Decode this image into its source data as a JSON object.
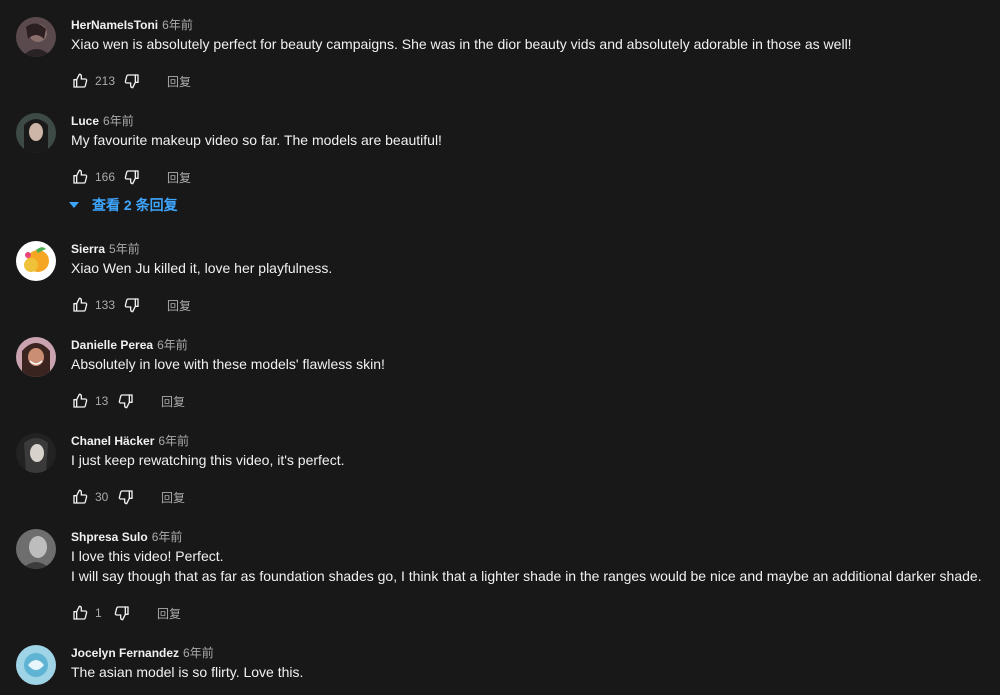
{
  "comments": [
    {
      "author": "HerNameIsToni",
      "time": "6年前",
      "text": "Xiao wen is absolutely perfect for beauty campaigns. She was in the dior beauty vids and absolutely adorable in those as well!",
      "likes": "213",
      "reply_label": "回复"
    },
    {
      "author": "Luce",
      "time": "6年前",
      "text": "My favourite makeup video so far. The models are beautiful!",
      "likes": "166",
      "reply_label": "回复",
      "view_replies": "查看 2 条回复"
    },
    {
      "author": "Sierra",
      "time": "5年前",
      "text": "Xiao Wen Ju killed it, love her playfulness.",
      "likes": "133",
      "reply_label": "回复"
    },
    {
      "author": "Danielle Perea",
      "time": "6年前",
      "text": "Absolutely in love with these models' flawless skin!",
      "likes": "13",
      "reply_label": "回复"
    },
    {
      "author": "Chanel Häcker",
      "time": "6年前",
      "text": "I just keep rewatching this video, it's perfect.",
      "likes": "30",
      "reply_label": "回复"
    },
    {
      "author": "Shpresa Sulo",
      "time": "6年前",
      "text_line1": "I love this video! Perfect.",
      "text_line2": "I will say though that as far as foundation shades go, I think that a lighter shade in the ranges would be nice and maybe an additional darker shade.",
      "likes": "1",
      "reply_label": "回复"
    },
    {
      "author": "Jocelyn Fernandez",
      "time": "6年前",
      "text": "The asian model is so flirty. Love this."
    }
  ],
  "colors": {
    "background": "#181818",
    "text": "#f1f1f1",
    "secondary": "#aaaaaa",
    "link": "#3ea6ff"
  },
  "icons": {
    "like": "thumb-up-outline-icon",
    "dislike": "thumb-down-outline-icon",
    "expand": "caret-down-icon"
  }
}
